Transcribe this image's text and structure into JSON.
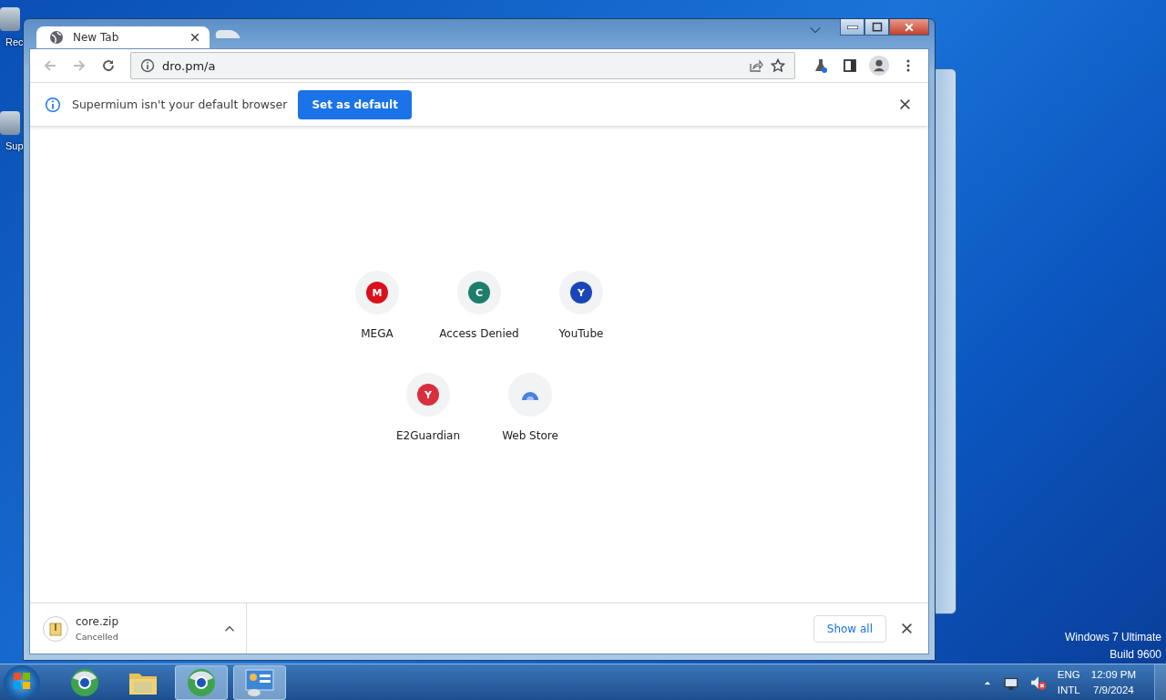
{
  "desktop": {
    "icons": [
      {
        "label": "Rec"
      },
      {
        "label": "Sup"
      }
    ],
    "edition": "Windows 7 Ultimate",
    "build": "Build 9600"
  },
  "browser": {
    "tabs": [
      {
        "title": "New Tab",
        "selected": true
      },
      {
        "selected": false
      }
    ],
    "address": "dro.pm/a",
    "infobar": {
      "message": "Supermium isn't your default browser",
      "button": "Set as default"
    },
    "shortcuts": [
      {
        "label": "MEGA",
        "kind": "letter",
        "letter": "M",
        "color": "#d9101b"
      },
      {
        "label": "Access Denied",
        "kind": "letter",
        "letter": "C",
        "color": "#1e7e6b"
      },
      {
        "label": "YouTube",
        "kind": "letter",
        "letter": "Y",
        "color": "#1a46b8"
      },
      {
        "label": "E2Guardian",
        "kind": "letter",
        "letter": "Y",
        "color": "#d82f3f"
      },
      {
        "label": "Web Store",
        "kind": "webstore"
      }
    ],
    "downloads": [
      {
        "name": "core.zip",
        "status": "Cancelled"
      }
    ],
    "show_all": "Show all"
  },
  "taskbar": {
    "apps": [
      {
        "kind": "browser",
        "selected": false
      },
      {
        "kind": "folder",
        "selected": false
      },
      {
        "kind": "browser",
        "selected": true
      },
      {
        "kind": "panel",
        "selected": true
      }
    ],
    "language": [
      "ENG",
      "INTL"
    ],
    "time": "12:09 PM",
    "date": "7/9/2024"
  }
}
